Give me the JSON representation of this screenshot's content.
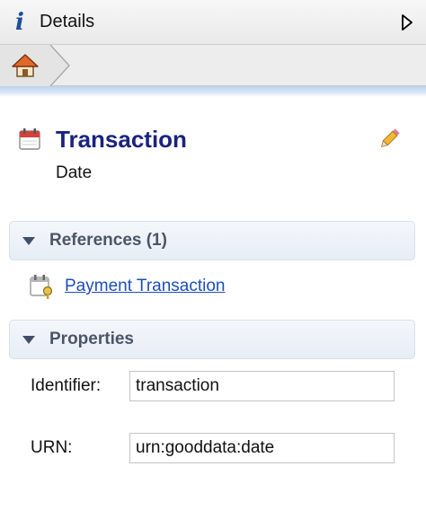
{
  "panel": {
    "title": "Details"
  },
  "icons": {
    "info": "info-icon",
    "collapse": "triangle-right-icon",
    "home": "home-icon",
    "calendar": "calendar-icon",
    "edit": "pencil-icon",
    "expand": "triangle-down-icon",
    "reference": "calendar-key-icon"
  },
  "info_glyph": "i",
  "entity": {
    "title": "Transaction",
    "subtitle": "Date"
  },
  "references": {
    "header": "References (1)",
    "items": [
      {
        "label": "Payment Transaction"
      }
    ]
  },
  "properties": {
    "header": "Properties",
    "fields": [
      {
        "label": "Identifier:",
        "value": "transaction"
      },
      {
        "label": "URN:",
        "value": "urn:gooddata:date"
      }
    ]
  },
  "colors": {
    "title": "#1a237e",
    "link": "#1d4fb8",
    "section_label": "#4a5568",
    "accent_strip": "#bcd2ee"
  }
}
